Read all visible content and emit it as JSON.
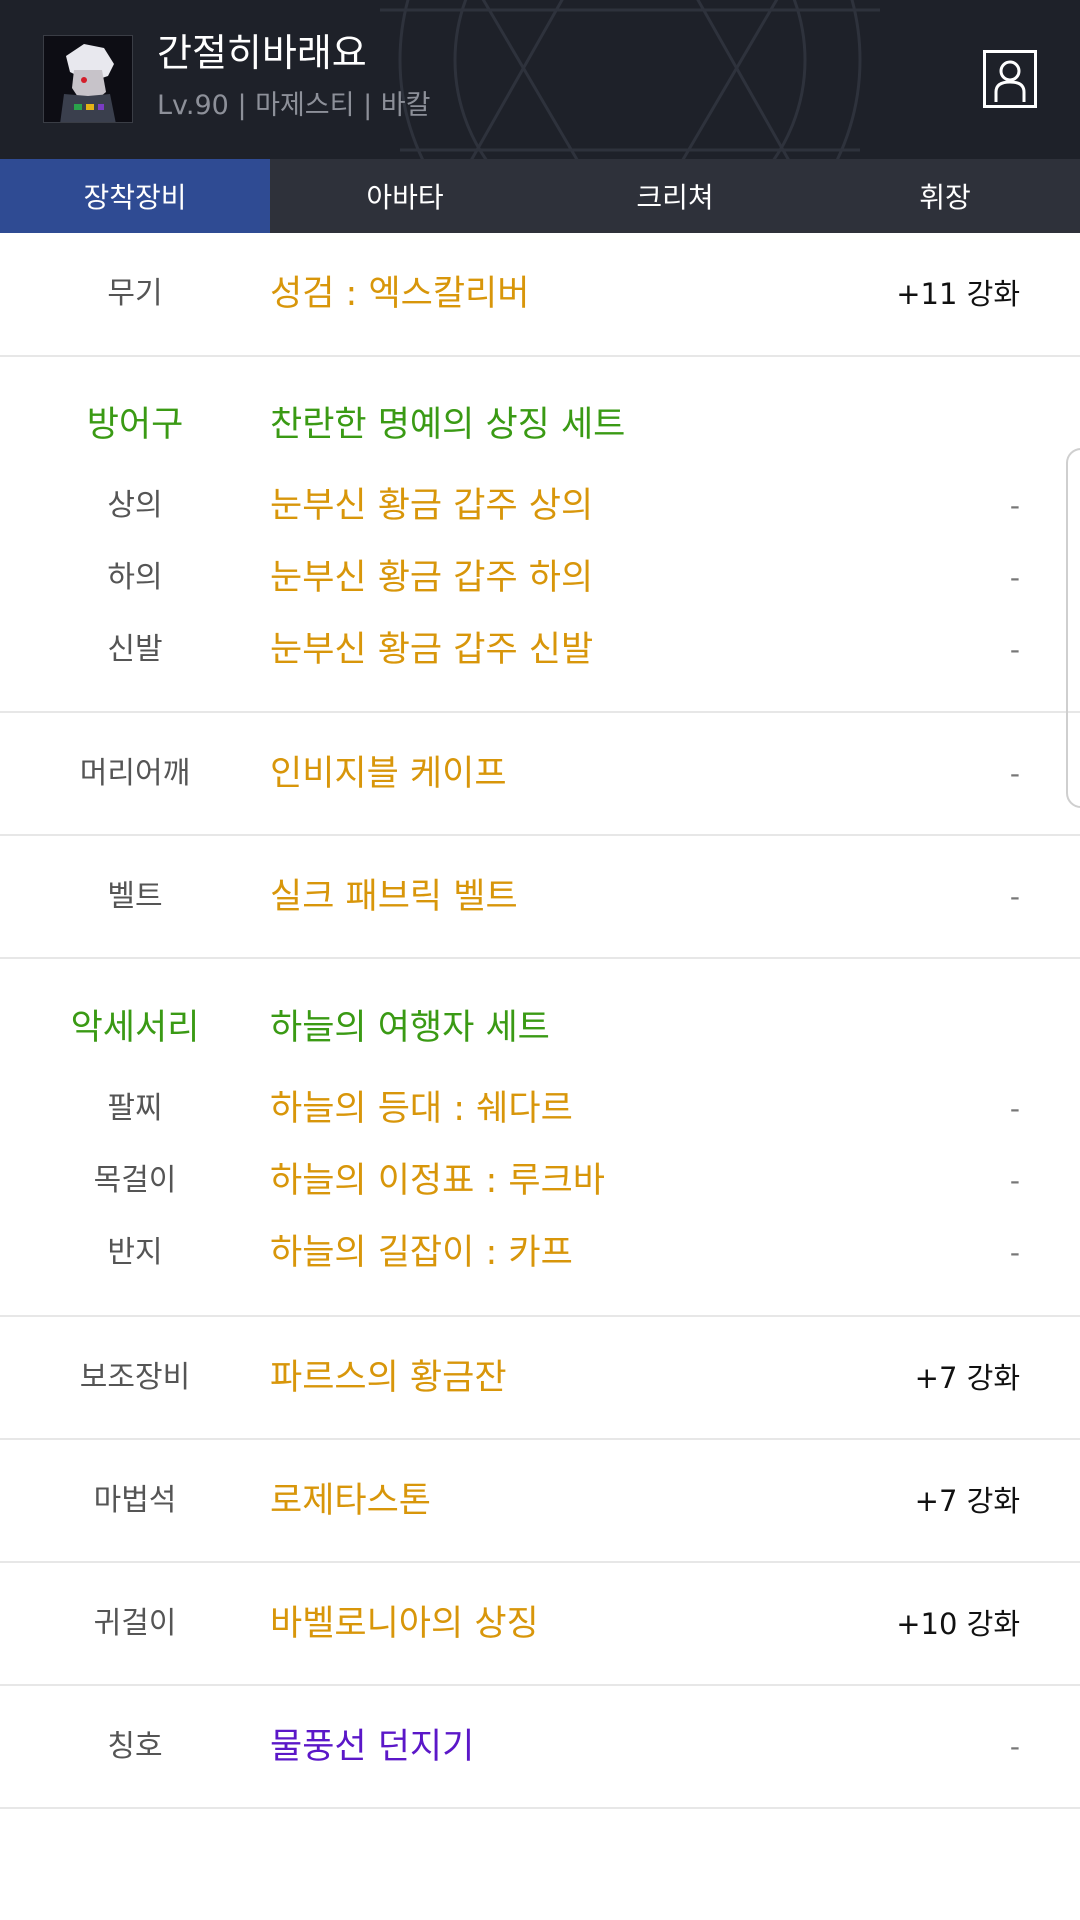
{
  "header": {
    "character_name": "간절히바래요",
    "character_info": "Lv.90 | 마제스티 | 바칼",
    "icons": {
      "avatar": "character-portrait",
      "profile": "person-icon"
    }
  },
  "tabs": [
    {
      "label": "장착장비",
      "active": true
    },
    {
      "label": "아바타",
      "active": false
    },
    {
      "label": "크리쳐",
      "active": false
    },
    {
      "label": "휘장",
      "active": false
    }
  ],
  "equipment": {
    "weapon": {
      "label": "무기",
      "name": "성검 : 엑스칼리버",
      "value": "+11 강화"
    },
    "armor": {
      "set_label": "방어구",
      "set_name": "찬란한 명예의 상징 세트",
      "top": {
        "label": "상의",
        "name": "눈부신 황금 갑주 상의",
        "value": "-"
      },
      "bottom": {
        "label": "하의",
        "name": "눈부신 황금 갑주 하의",
        "value": "-"
      },
      "shoes": {
        "label": "신발",
        "name": "눈부신 황금 갑주 신발",
        "value": "-"
      }
    },
    "shoulder": {
      "label": "머리어깨",
      "name": "인비지블 케이프",
      "value": "-"
    },
    "belt": {
      "label": "벨트",
      "name": "실크 패브릭 벨트",
      "value": "-"
    },
    "accessory": {
      "set_label": "악세서리",
      "set_name": "하늘의 여행자 세트",
      "bracelet": {
        "label": "팔찌",
        "name": "하늘의 등대 : 쉐다르",
        "value": "-"
      },
      "necklace": {
        "label": "목걸이",
        "name": "하늘의 이정표 : 루크바",
        "value": "-"
      },
      "ring": {
        "label": "반지",
        "name": "하늘의 길잡이 : 카프",
        "value": "-"
      }
    },
    "sub": {
      "label": "보조장비",
      "name": "파르스의 황금잔",
      "value": "+7 강화"
    },
    "magic_stone": {
      "label": "마법석",
      "name": "로제타스톤",
      "value": "+7 강화"
    },
    "earring": {
      "label": "귀걸이",
      "name": "바벨로니아의 상징",
      "value": "+10 강화"
    },
    "title": {
      "label": "칭호",
      "name": "물풍선 던지기",
      "value": "-"
    }
  },
  "colors": {
    "header_bg": "#1e2129",
    "tab_bar_bg": "#2e313a",
    "tab_active_bg": "#2f4b93",
    "item_gold": "#d8960a",
    "set_green": "#3a9a14",
    "title_purple": "#5b17c8"
  }
}
